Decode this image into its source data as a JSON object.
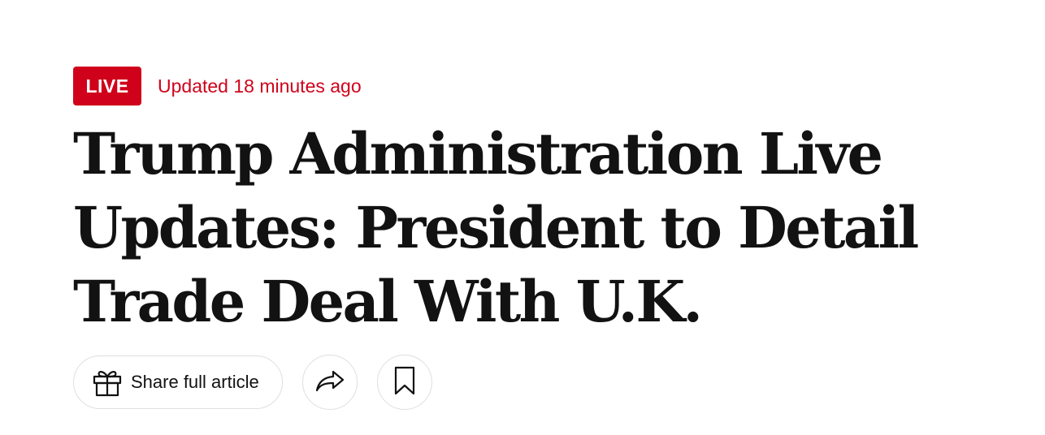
{
  "header": {
    "live_label": "LIVE",
    "updated_text": "Updated 18 minutes ago"
  },
  "headline": "Trump Administration Live Updates: President to Detail Trade Deal With U.K.",
  "actions": {
    "share_label": "Share full article",
    "icons": [
      "gift-icon",
      "forward-arrow-icon",
      "bookmark-icon"
    ]
  },
  "colors": {
    "live_red": "#d0021b",
    "headline_text": "#121212",
    "button_border": "#dfdfdf"
  }
}
